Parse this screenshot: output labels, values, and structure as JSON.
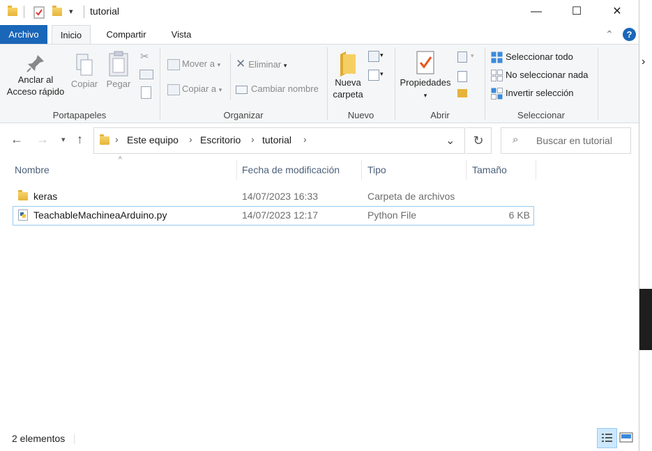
{
  "window": {
    "title": "tutorial"
  },
  "ribbon_tabs": [
    {
      "label": "Archivo"
    },
    {
      "label": "Inicio"
    },
    {
      "label": "Compartir"
    },
    {
      "label": "Vista"
    }
  ],
  "help_glyph": "?",
  "ribbon": {
    "portapapeles": {
      "label": "Portapapeles",
      "pin_line1": "Anclar al",
      "pin_line2": "Acceso rápido",
      "copy": "Copiar",
      "paste": "Pegar"
    },
    "organizar": {
      "label": "Organizar",
      "move_to": "Mover a",
      "copy_to": "Copiar a",
      "delete": "Eliminar",
      "rename": "Cambiar nombre"
    },
    "nuevo": {
      "label": "Nuevo",
      "new_folder_line1": "Nueva",
      "new_folder_line2": "carpeta"
    },
    "abrir": {
      "label": "Abrir",
      "properties": "Propiedades"
    },
    "seleccionar": {
      "label": "Seleccionar",
      "select_all": "Seleccionar todo",
      "select_none": "No seleccionar nada",
      "invert": "Invertir selección"
    }
  },
  "address": {
    "crumbs": [
      "Este equipo",
      "Escritorio",
      "tutorial"
    ],
    "search_placeholder": "Buscar en tutorial"
  },
  "columns": [
    "Nombre",
    "Fecha de modificación",
    "Tipo",
    "Tamaño"
  ],
  "files": [
    {
      "name": "keras",
      "modified": "14/07/2023 16:33",
      "type": "Carpeta de archivos",
      "size": "",
      "icon": "folder-icon"
    },
    {
      "name": "TeachableMachineaArduino.py",
      "modified": "14/07/2023 12:17",
      "type": "Python File",
      "size": "6 KB",
      "icon": "python-file-icon"
    }
  ],
  "status": {
    "count": "2 elementos"
  },
  "colors": {
    "accent": "#1a66b8",
    "selection_border": "#99c9ef",
    "header_text": "#4c607a"
  }
}
